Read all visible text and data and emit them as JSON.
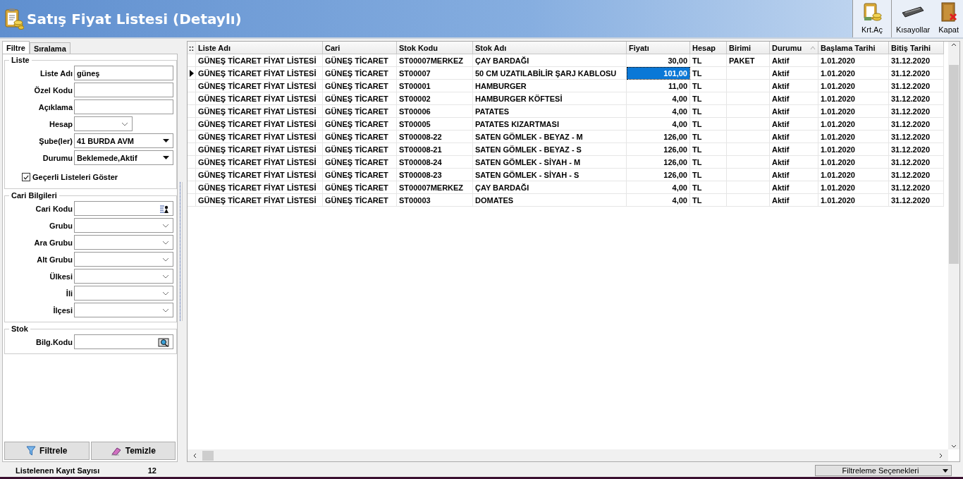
{
  "window": {
    "title": "Satış Fiyat Listesi (Detaylı)"
  },
  "toolbar": [
    {
      "label": "Krt.Aç",
      "kind": "open"
    },
    {
      "label": "Kısayollar",
      "kind": "keyboard"
    },
    {
      "label": "Kapat",
      "kind": "close"
    }
  ],
  "tabs": [
    {
      "label": "Filtre",
      "selected": true
    },
    {
      "label": "Sıralama",
      "selected": false
    }
  ],
  "sections": [
    {
      "title": "Liste",
      "fields": [
        {
          "label": "Liste Adı",
          "kind": "text",
          "value": "güneş"
        },
        {
          "label": "Özel Kodu",
          "kind": "text"
        },
        {
          "label": "Açıklama",
          "kind": "text"
        },
        {
          "label": "Hesap",
          "kind": "small-combo"
        },
        {
          "label": "Şube(ler)",
          "kind": "select",
          "value": "41 BURDA AVM"
        },
        {
          "label": "Durumu",
          "kind": "select",
          "value": "Beklemede,Aktif"
        },
        {
          "label": "Geçerli Listeleri Göster",
          "kind": "checkbox",
          "checked": true
        }
      ]
    },
    {
      "title": "Cari Bilgileri",
      "fields": [
        {
          "label": "Cari Kodu",
          "kind": "lookup"
        },
        {
          "label": "Grubu",
          "kind": "combo"
        },
        {
          "label": "Ara Grubu",
          "kind": "combo"
        },
        {
          "label": "Alt Grubu",
          "kind": "combo"
        },
        {
          "label": "Ülkesi",
          "kind": "combo"
        },
        {
          "label": "İli",
          "kind": "combo"
        },
        {
          "label": "İlçesi",
          "kind": "combo"
        }
      ]
    },
    {
      "title": "Stok",
      "fields": [
        {
          "label": "Bilg.Kodu",
          "kind": "finder"
        }
      ]
    }
  ],
  "buttons": [
    {
      "label": "Filtrele",
      "kind": "filter"
    },
    {
      "label": "Temizle",
      "kind": "clear"
    }
  ],
  "grid": {
    "corner": "::",
    "columns": [
      {
        "label": "Liste Adı",
        "sorted": false
      },
      {
        "label": "Cari",
        "sorted": false
      },
      {
        "label": "Stok Kodu",
        "sorted": false
      },
      {
        "label": "Stok Adı",
        "sorted": false
      },
      {
        "label": "Fiyatı",
        "sorted": false
      },
      {
        "label": "Hesap",
        "sorted": false
      },
      {
        "label": "Birimi",
        "sorted": false
      },
      {
        "label": "Durumu",
        "sorted": true
      },
      {
        "label": "Başlama Tarihi",
        "sorted": false
      },
      {
        "label": "Bitiş Tarihi",
        "sorted": false
      }
    ],
    "rows": [
      {
        "selected": false,
        "cells": [
          "GÜNEŞ TİCARET FİYAT LİSTESİ",
          "GÜNEŞ TİCARET",
          "ST00007MERKEZ",
          "ÇAY BARDAĞI",
          "30,00",
          "TL",
          "PAKET",
          "Aktif",
          "1.01.2020",
          "31.12.2020"
        ]
      },
      {
        "selected": true,
        "cells": [
          "GÜNEŞ TİCARET FİYAT LİSTESİ",
          "GÜNEŞ TİCARET",
          "ST00007",
          "50 CM UZATILABİLİR ŞARJ KABLOSU",
          "101,00",
          "TL",
          "",
          "Aktif",
          "1.01.2020",
          "31.12.2020"
        ]
      },
      {
        "selected": false,
        "cells": [
          "GÜNEŞ TİCARET FİYAT LİSTESİ",
          "GÜNEŞ TİCARET",
          "ST00001",
          "HAMBURGER",
          "11,00",
          "TL",
          "",
          "Aktif",
          "1.01.2020",
          "31.12.2020"
        ]
      },
      {
        "selected": false,
        "cells": [
          "GÜNEŞ TİCARET FİYAT LİSTESİ",
          "GÜNEŞ TİCARET",
          "ST00002",
          "HAMBURGER KÖFTESİ",
          "4,00",
          "TL",
          "",
          "Aktif",
          "1.01.2020",
          "31.12.2020"
        ]
      },
      {
        "selected": false,
        "cells": [
          "GÜNEŞ TİCARET FİYAT LİSTESİ",
          "GÜNEŞ TİCARET",
          "ST00006",
          "PATATES",
          "4,00",
          "TL",
          "",
          "Aktif",
          "1.01.2020",
          "31.12.2020"
        ]
      },
      {
        "selected": false,
        "cells": [
          "GÜNEŞ TİCARET FİYAT LİSTESİ",
          "GÜNEŞ TİCARET",
          "ST00005",
          "PATATES KIZARTMASI",
          "4,00",
          "TL",
          "",
          "Aktif",
          "1.01.2020",
          "31.12.2020"
        ]
      },
      {
        "selected": false,
        "cells": [
          "GÜNEŞ TİCARET FİYAT LİSTESİ",
          "GÜNEŞ TİCARET",
          "ST00008-22",
          "SATEN GÖMLEK - BEYAZ - M",
          "126,00",
          "TL",
          "",
          "Aktif",
          "1.01.2020",
          "31.12.2020"
        ]
      },
      {
        "selected": false,
        "cells": [
          "GÜNEŞ TİCARET FİYAT LİSTESİ",
          "GÜNEŞ TİCARET",
          "ST00008-21",
          "SATEN GÖMLEK - BEYAZ - S",
          "126,00",
          "TL",
          "",
          "Aktif",
          "1.01.2020",
          "31.12.2020"
        ]
      },
      {
        "selected": false,
        "cells": [
          "GÜNEŞ TİCARET FİYAT LİSTESİ",
          "GÜNEŞ TİCARET",
          "ST00008-24",
          "SATEN GÖMLEK - SİYAH - M",
          "126,00",
          "TL",
          "",
          "Aktif",
          "1.01.2020",
          "31.12.2020"
        ]
      },
      {
        "selected": false,
        "cells": [
          "GÜNEŞ TİCARET FİYAT LİSTESİ",
          "GÜNEŞ TİCARET",
          "ST00008-23",
          "SATEN GÖMLEK - SİYAH - S",
          "126,00",
          "TL",
          "",
          "Aktif",
          "1.01.2020",
          "31.12.2020"
        ]
      },
      {
        "selected": false,
        "cells": [
          "GÜNEŞ TİCARET FİYAT LİSTESİ",
          "GÜNEŞ TİCARET",
          "ST00007MERKEZ",
          "ÇAY BARDAĞI",
          "4,00",
          "TL",
          "",
          "Aktif",
          "1.01.2020",
          "31.12.2020"
        ]
      },
      {
        "selected": false,
        "cells": [
          "GÜNEŞ TİCARET FİYAT LİSTESİ",
          "GÜNEŞ TİCARET",
          "ST00003",
          "DOMATES",
          "4,00",
          "TL",
          "",
          "Aktif",
          "1.01.2020",
          "31.12.2020"
        ]
      }
    ]
  },
  "status_bar": {
    "label": "Listelenen Kayıt Sayısı",
    "count": "12",
    "options": "Filtreleme Seçenekleri"
  }
}
